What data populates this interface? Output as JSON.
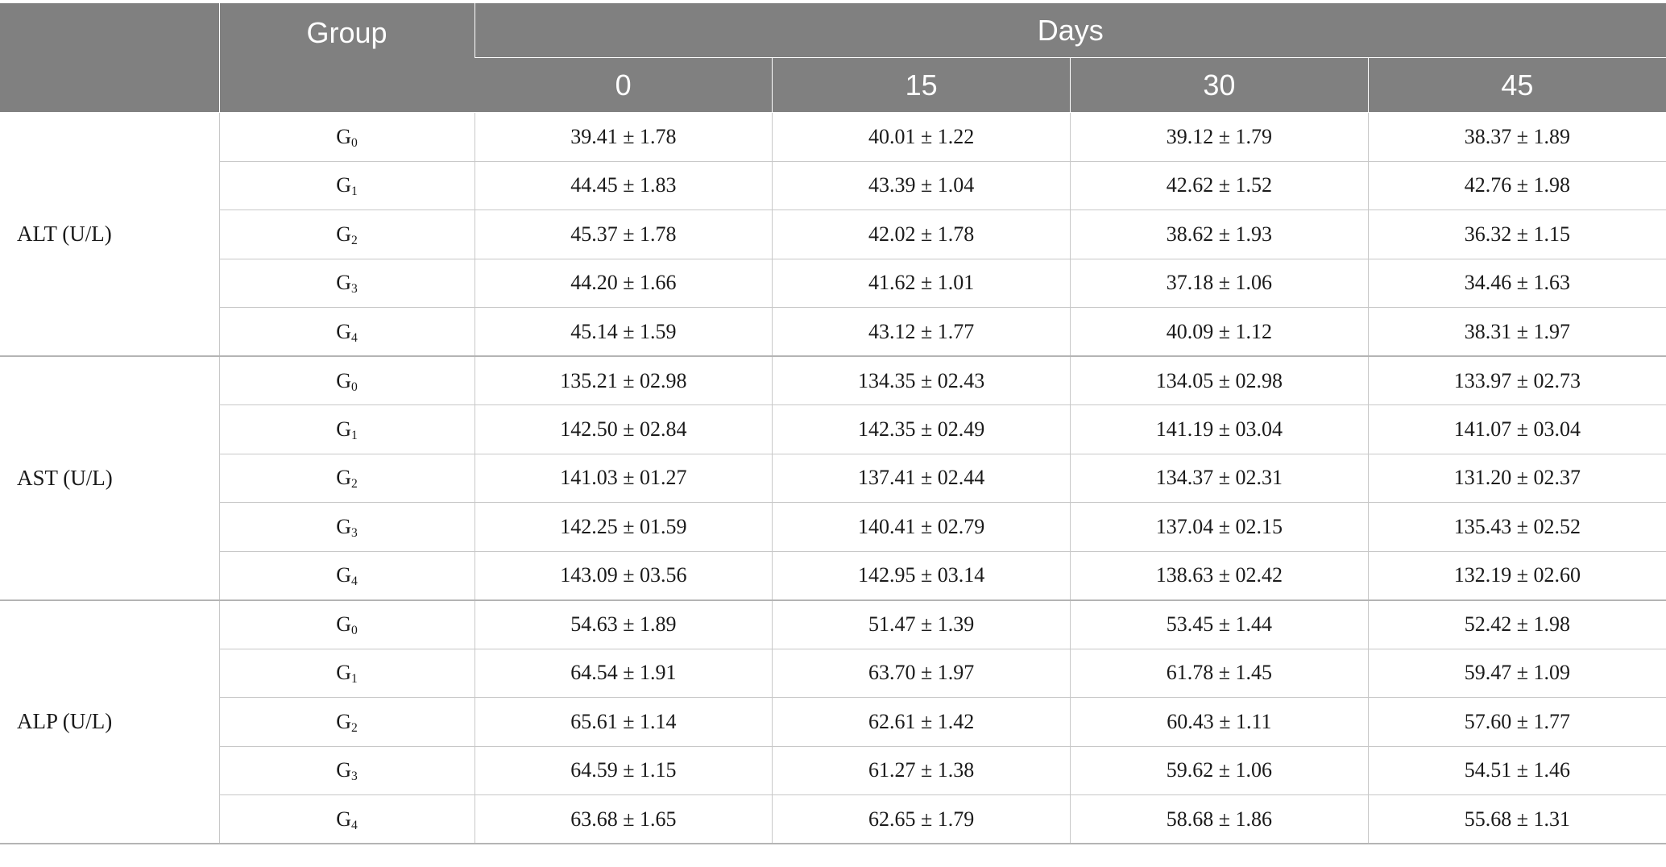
{
  "header": {
    "group_label": "Group",
    "days_label": "Days",
    "days": [
      "0",
      "15",
      "30",
      "45"
    ]
  },
  "rows": [
    {
      "param": "ALT (U/L)",
      "groups": [
        {
          "g": "G",
          "sub": "0",
          "vals": [
            "39.41 ± 1.78",
            "40.01 ± 1.22",
            "39.12 ± 1.79",
            "38.37 ± 1.89"
          ]
        },
        {
          "g": "G",
          "sub": "1",
          "vals": [
            "44.45 ± 1.83",
            "43.39 ± 1.04",
            "42.62 ± 1.52",
            "42.76 ± 1.98"
          ]
        },
        {
          "g": "G",
          "sub": "2",
          "vals": [
            "45.37 ± 1.78",
            "42.02 ± 1.78",
            "38.62 ± 1.93",
            "36.32 ± 1.15"
          ]
        },
        {
          "g": "G",
          "sub": "3",
          "vals": [
            "44.20 ± 1.66",
            "41.62 ± 1.01",
            "37.18 ± 1.06",
            "34.46 ± 1.63"
          ]
        },
        {
          "g": "G",
          "sub": "4",
          "vals": [
            "45.14 ± 1.59",
            "43.12 ± 1.77",
            "40.09 ± 1.12",
            "38.31 ± 1.97"
          ]
        }
      ]
    },
    {
      "param": "AST (U/L)",
      "groups": [
        {
          "g": "G",
          "sub": "0",
          "vals": [
            "135.21 ± 02.98",
            "134.35 ± 02.43",
            "134.05 ± 02.98",
            "133.97 ± 02.73"
          ]
        },
        {
          "g": "G",
          "sub": "1",
          "vals": [
            "142.50 ± 02.84",
            "142.35 ± 02.49",
            "141.19 ± 03.04",
            "141.07 ± 03.04"
          ]
        },
        {
          "g": "G",
          "sub": "2",
          "vals": [
            "141.03 ± 01.27",
            "137.41 ± 02.44",
            "134.37 ± 02.31",
            "131.20 ± 02.37"
          ]
        },
        {
          "g": "G",
          "sub": "3",
          "vals": [
            "142.25 ± 01.59",
            "140.41 ± 02.79",
            "137.04 ± 02.15",
            "135.43 ± 02.52"
          ]
        },
        {
          "g": "G",
          "sub": "4",
          "vals": [
            "143.09 ± 03.56",
            "142.95 ± 03.14",
            "138.63 ± 02.42",
            "132.19 ± 02.60"
          ]
        }
      ]
    },
    {
      "param": "ALP (U/L)",
      "groups": [
        {
          "g": "G",
          "sub": "0",
          "vals": [
            "54.63 ± 1.89",
            "51.47 ± 1.39",
            "53.45 ± 1.44",
            "52.42 ± 1.98"
          ]
        },
        {
          "g": "G",
          "sub": "1",
          "vals": [
            "64.54 ± 1.91",
            "63.70 ± 1.97",
            "61.78 ± 1.45",
            "59.47 ± 1.09"
          ]
        },
        {
          "g": "G",
          "sub": "2",
          "vals": [
            "65.61 ± 1.14",
            "62.61 ± 1.42",
            "60.43 ± 1.11",
            "57.60 ± 1.77"
          ]
        },
        {
          "g": "G",
          "sub": "3",
          "vals": [
            "64.59 ± 1.15",
            "61.27 ± 1.38",
            "59.62 ± 1.06",
            "54.51 ± 1.46"
          ]
        },
        {
          "g": "G",
          "sub": "4",
          "vals": [
            "63.68 ± 1.65",
            "62.65 ± 1.79",
            "58.68 ± 1.86",
            "55.68 ± 1.31"
          ]
        }
      ]
    }
  ]
}
